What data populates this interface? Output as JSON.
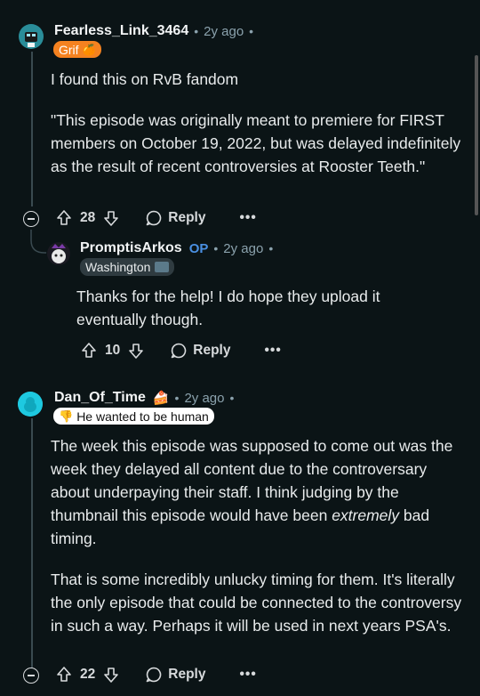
{
  "comments": [
    {
      "username": "Fearless_Link_3464",
      "time": "2y ago",
      "flair": "Grif",
      "paragraphs": [
        "I found this on RvB fandom",
        "\"This episode was originally meant to premiere for FIRST members on October 19, 2022, but was delayed indefinitely as the result of recent controversies at Rooster Teeth.\""
      ],
      "votes": "28",
      "reply_label": "Reply"
    },
    {
      "username": "PromptisArkos",
      "op_label": "OP",
      "time": "2y ago",
      "flair": "Washington",
      "paragraphs": [
        "Thanks for the help! I do hope they upload it eventually though."
      ],
      "votes": "10",
      "reply_label": "Reply"
    },
    {
      "username": "Dan_Of_Time",
      "time": "2y ago",
      "flair": "He wanted to be human",
      "paragraphs": [
        "The week this episode was supposed to come out was the week they delayed all content due to the controversary about underpaying their staff. I think judging by the thumbnail this episode would have been",
        "extremely",
        " bad timing.",
        "That is some incredibly unlucky timing for them. It's literally the only episode that could be connected to the controversy in such a way. Perhaps it will be used in next years PSA's."
      ],
      "votes": "22",
      "reply_label": "Reply"
    }
  ],
  "colors": {
    "background": "#0b1416",
    "grif_flair": "#f58220",
    "op_blue": "#4a90e2"
  }
}
